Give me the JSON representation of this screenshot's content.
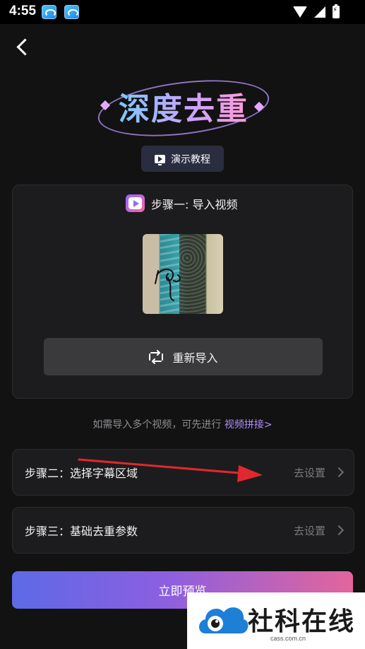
{
  "status_bar": {
    "time": "4:55"
  },
  "header": {
    "logo_title": "深度去重"
  },
  "tutorial": {
    "label": "演示教程"
  },
  "step1": {
    "title": "步骤一: 导入视频",
    "reimport_label": "重新导入"
  },
  "hint": {
    "text": "如需导入多个视频，可先进行",
    "link": "视频拼接>"
  },
  "step2": {
    "title": "步骤二：选择字幕区域",
    "action": "去设置"
  },
  "step3": {
    "title": "步骤三：基础去重参数",
    "action": "去设置"
  },
  "preview": {
    "label": "立即预览"
  },
  "watermark": {
    "name": "社科在线",
    "url": "cass.com.cn"
  },
  "colors": {
    "background": "#121212",
    "accent_purple": "#b48cff",
    "gradient_start": "#5d6ae6",
    "gradient_end": "#e3659c",
    "annotation_arrow": "#e0282e"
  }
}
